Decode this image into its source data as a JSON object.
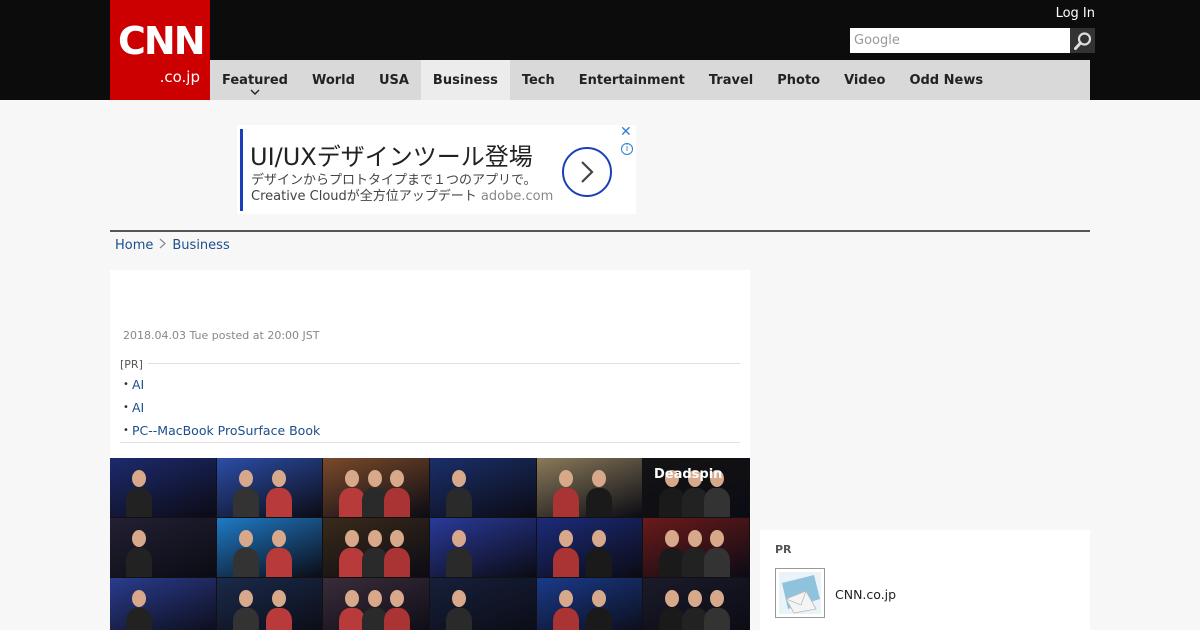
{
  "header": {
    "logo_text": "CNN",
    "logo_sub": ".co.jp",
    "login_label": "Log In",
    "search_placeholder": "Google",
    "search_icon": "magnifier-icon"
  },
  "nav": {
    "items": [
      {
        "label": "Featured",
        "has_dropdown": true
      },
      {
        "label": "World"
      },
      {
        "label": "USA"
      },
      {
        "label": "Business",
        "active": true
      },
      {
        "label": "Tech"
      },
      {
        "label": "Entertainment"
      },
      {
        "label": "Travel"
      },
      {
        "label": "Photo"
      },
      {
        "label": "Video"
      },
      {
        "label": "Odd News"
      }
    ]
  },
  "ad": {
    "title": "UI/UXデザインツール登場",
    "line1": "デザインからプロトタイプまで１つのアプリで。",
    "line2": "Creative Cloudが全方位アップデート",
    "domain": "adobe.com",
    "close_symbol": "✕",
    "info_symbol": "i"
  },
  "breadcrumb": {
    "home": "Home",
    "current": "Business"
  },
  "article": {
    "date": "2018.04.03 Tue posted at 20:00 JST",
    "pr_label": "[PR]",
    "pr_links": [
      "AI",
      "AI",
      "PC--MacBook ProSurface Book"
    ],
    "image_text": "Deadspin"
  },
  "sidebar": {
    "pr_label": "PR",
    "item_text": "CNN.co.jp"
  },
  "colors": {
    "brand_red": "#cc0000",
    "header_bg": "#0c0c0c",
    "nav_bg": "#d9d9d9",
    "link": "#1b4f8a"
  }
}
